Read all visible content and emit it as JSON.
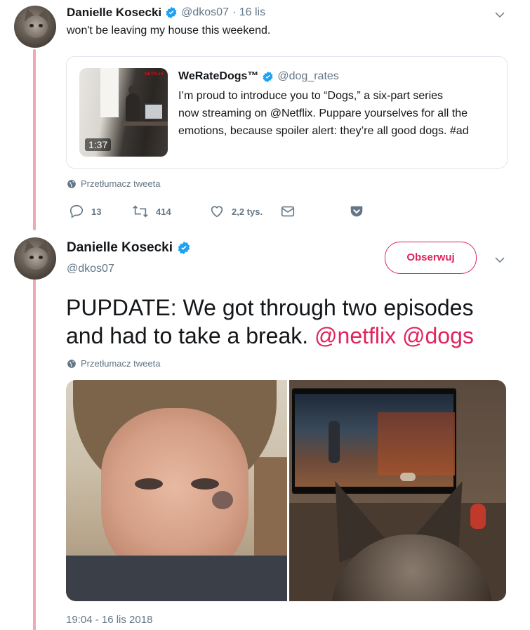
{
  "tweet1": {
    "author_name": "Danielle Kosecki",
    "handle": "@dkos07",
    "time": "· 16 lis",
    "text": "won't be leaving my house this weekend.",
    "quoted": {
      "author_name": "WeRateDogs™",
      "handle": "@dog_rates",
      "text_lines": [
        "I’m proud to introduce you to “Dogs,” a six-part series",
        "now streaming on @Netflix. Puppare yourselves for all the",
        "emotions, because spoiler alert: they’re all good dogs. #ad"
      ],
      "video_duration": "1:37",
      "thumbnail_brand": "NETFLIX"
    },
    "translate_label": "Przetłumacz tweeta",
    "actions": {
      "replies": "13",
      "retweets": "414",
      "likes": "2,2 tys."
    }
  },
  "tweet2": {
    "author_name": "Danielle Kosecki",
    "handle": "@dkos07",
    "follow_label": "Obserwuj",
    "text_plain_1": "PUPDATE: We got through two episodes",
    "text_plain_2": "and had to take a break. ",
    "mention_1": "@netflix",
    "mention_2": "@dogs",
    "translate_label": "Przetłumacz tweeta",
    "timestamp": "19:04 - 16 lis 2018"
  },
  "colors": {
    "accent": "#e0245e",
    "verified": "#1da1f2",
    "muted": "#657786",
    "thread": "#f0a8b9"
  }
}
